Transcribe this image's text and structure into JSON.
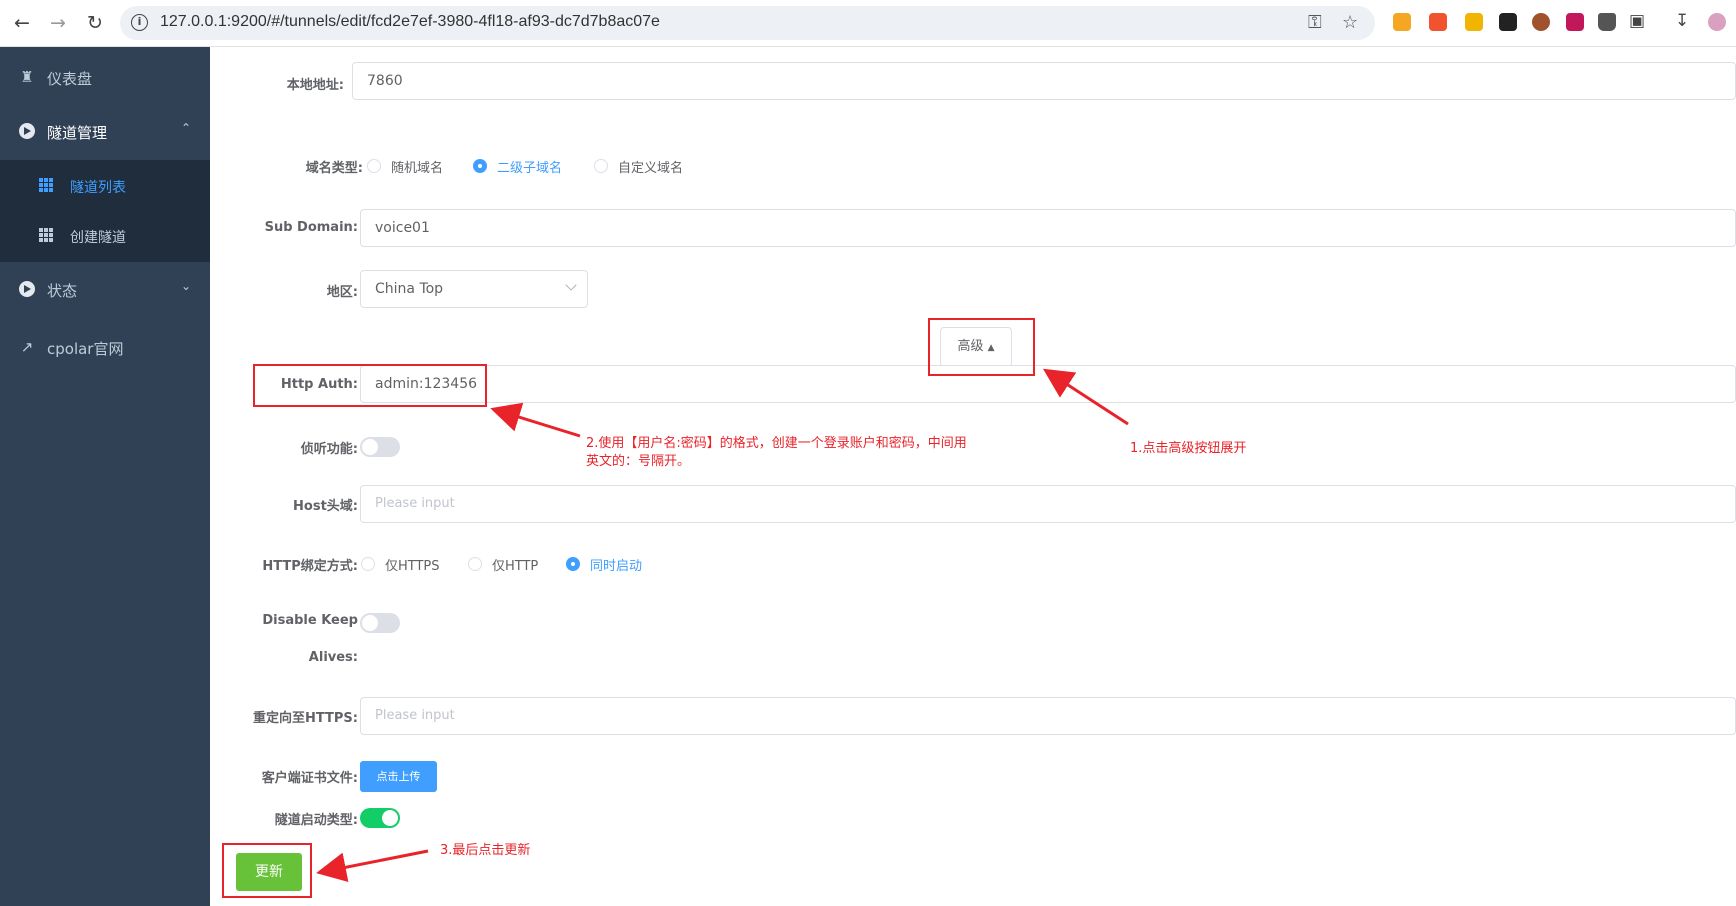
{
  "browser": {
    "url": "127.0.0.1:9200/#/tunnels/edit/fcd2e7ef-3980-4fl18-af93-dc7d7b8ac07e"
  },
  "sidebar": {
    "dashboard": "仪表盘",
    "tunnel_mgmt": "隧道管理",
    "tunnel_list": "隧道列表",
    "create_tunnel": "创建隧道",
    "status": "状态",
    "cpolar_site": "cpolar官网"
  },
  "form": {
    "local_address_label": "本地地址:",
    "local_address_value": "7860",
    "domain_type_label": "域名类型:",
    "domain_type_options": [
      "随机域名",
      "二级子域名",
      "自定义域名"
    ],
    "domain_type_selected": "二级子域名",
    "subdomain_label": "Sub Domain:",
    "subdomain_value": "voice01",
    "region_label": "地区:",
    "region_value": "China Top",
    "advanced_button": "高级",
    "http_auth_label": "Http Auth:",
    "http_auth_value": "admin:123456",
    "listen_label": "侦听功能:",
    "listen_on": false,
    "host_header_label": "Host头域:",
    "host_header_placeholder": "Please input",
    "http_bind_label": "HTTP绑定方式:",
    "http_bind_options": [
      "仅HTTPS",
      "仅HTTP",
      "同时启动"
    ],
    "http_bind_selected": "同时启动",
    "disable_keepalive_label_1": "Disable Keep",
    "disable_keepalive_label_2": "Alives:",
    "disable_keepalive_on": false,
    "redirect_https_label": "重定向至HTTPS:",
    "redirect_https_placeholder": "Please input",
    "client_cert_label": "客户端证书文件:",
    "upload_button": "点击上传",
    "tunnel_start_label": "隧道启动类型:",
    "tunnel_start_on": true,
    "update_button": "更新"
  },
  "annotations": {
    "note1": "1.点击高级按钮展开",
    "note2_line1": "2.使用【用户名:密码】的格式，创建一个登录账户和密码，中间用",
    "note2_line2": "英文的：号隔开。",
    "note3": "3.最后点击更新",
    "color": "#e8232a"
  },
  "colors": {
    "sidebar_bg": "#304156",
    "submenu_bg": "#1f2d3d",
    "primary": "#409eff",
    "success": "#67c23a",
    "switch_on": "#13ce66"
  }
}
